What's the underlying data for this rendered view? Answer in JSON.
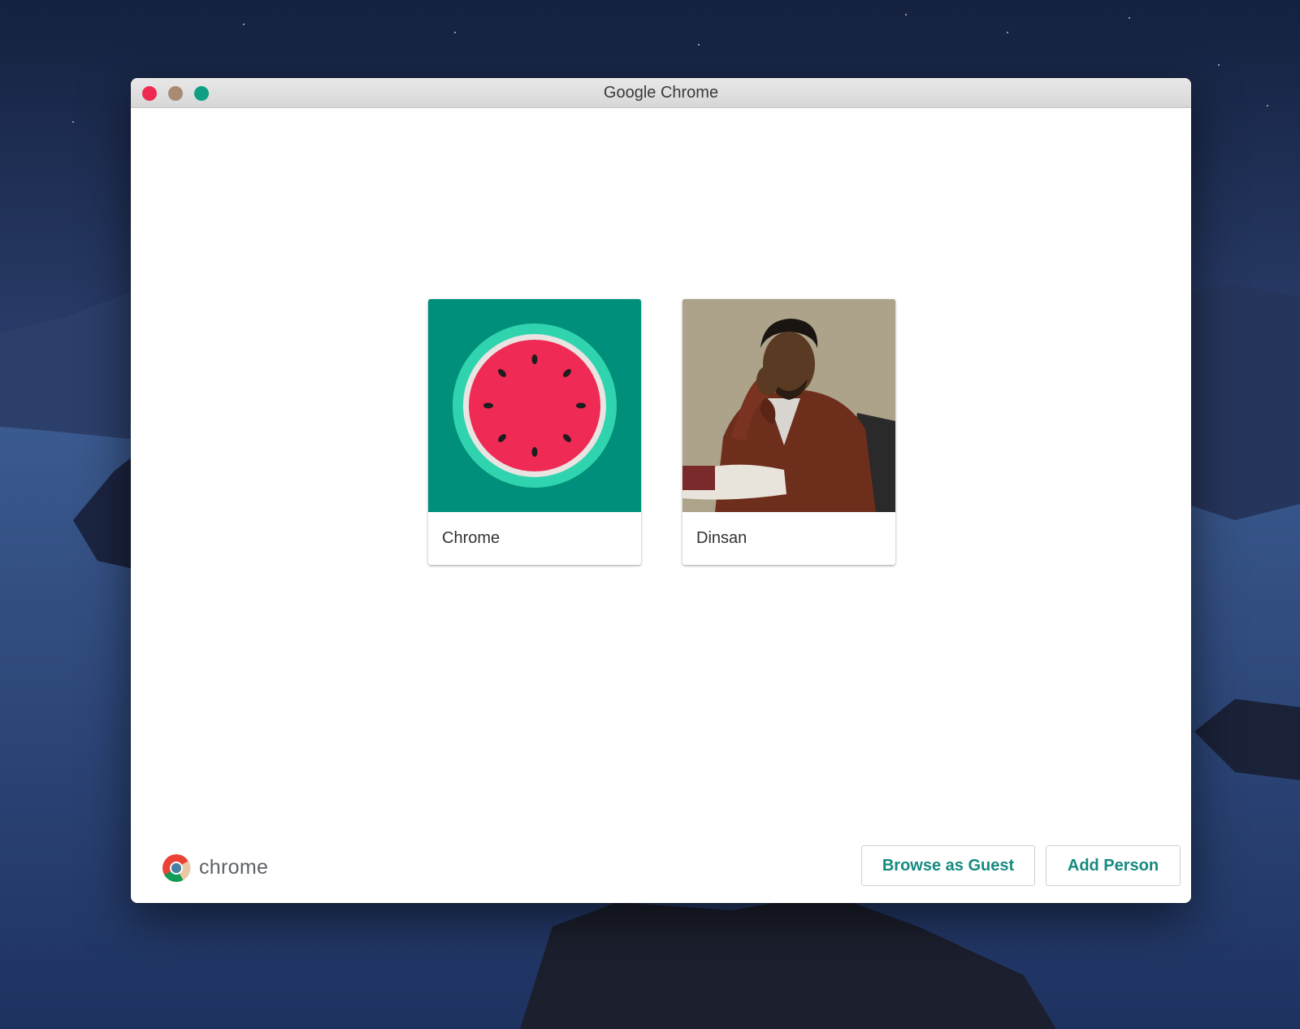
{
  "window": {
    "title": "Google Chrome",
    "traffic_lights": {
      "close_color": "#ee2a50",
      "minimize_color": "#a98a73",
      "zoom_color": "#0fa083"
    }
  },
  "profiles": [
    {
      "name": "Chrome",
      "avatar": "watermelon-avatar",
      "avatar_bg": "#008f7a"
    },
    {
      "name": "Dinsan",
      "avatar": "person-photo",
      "avatar_bg": "#a89f85"
    }
  ],
  "footer": {
    "brand_text": "chrome",
    "browse_guest_label": "Browse as Guest",
    "add_person_label": "Add Person"
  },
  "colors": {
    "accent": "#168a7f",
    "desktop_background": "#1a2a4e"
  }
}
